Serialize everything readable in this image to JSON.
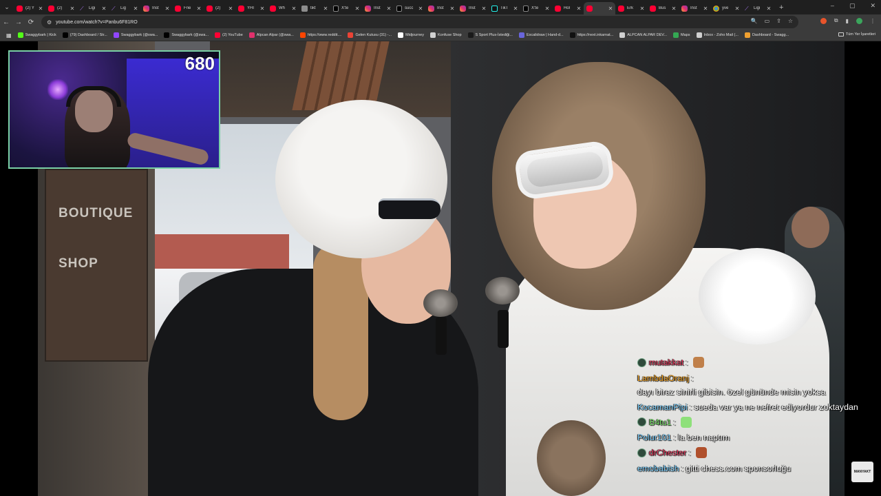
{
  "tabs": [
    {
      "title": "(2) Y",
      "fav": "yt"
    },
    {
      "title": "(2)",
      "fav": "yt"
    },
    {
      "title": "Ligi",
      "fav": "lig"
    },
    {
      "title": "Lig",
      "fav": "lig"
    },
    {
      "title": "Inst",
      "fav": "ig"
    },
    {
      "title": "Frie",
      "fav": "yt"
    },
    {
      "title": "(2)",
      "fav": "yt"
    },
    {
      "title": "YHI",
      "fav": "yt"
    },
    {
      "title": "Wh",
      "fav": "yt"
    },
    {
      "title": "tikt",
      "fav": "doc"
    },
    {
      "title": "X'te",
      "fav": "x"
    },
    {
      "title": "Inst",
      "fav": "ig"
    },
    {
      "title": "succ",
      "fav": "x"
    },
    {
      "title": "Inst",
      "fav": "ig"
    },
    {
      "title": "Inst",
      "fav": "ig"
    },
    {
      "title": "TikT",
      "fav": "tt"
    },
    {
      "title": "X'te",
      "fav": "x"
    },
    {
      "title": "Hol",
      "fav": "yt"
    },
    {
      "title": "",
      "fav": "yt",
      "active": true
    },
    {
      "title": "Erk",
      "fav": "yt"
    },
    {
      "title": "Bus",
      "fav": "yt"
    },
    {
      "title": "Inst",
      "fav": "ig"
    },
    {
      "title": "yve",
      "fav": "chrome"
    },
    {
      "title": "Ligi",
      "fav": "lig"
    }
  ],
  "toolbar": {
    "url": "youtube.com/watch?v=Panbu6F81RO"
  },
  "bookmarks": [
    {
      "label": "Swaggybark | Kick",
      "color": "#53fc18"
    },
    {
      "label": "(79) Dashboard / Str...",
      "color": "#000000"
    },
    {
      "label": "Swaggybark (@swa...",
      "color": "#9146ff"
    },
    {
      "label": "Swaggybark (@swa...",
      "color": "#000000"
    },
    {
      "label": "(2) YouTube",
      "color": "#ff0033"
    },
    {
      "label": "Alpcan Alpar (@swa...",
      "color": "#e1306c"
    },
    {
      "label": "https://www.reddit....",
      "color": "#ff4500"
    },
    {
      "label": "Gelen Kutusu (31) -...",
      "color": "#ea4335"
    },
    {
      "label": "Midjourney",
      "color": "#ffffff"
    },
    {
      "label": "Konfuse Shop",
      "color": "#d0d0d0"
    },
    {
      "label": "S Sport Plus-İstediği...",
      "color": "#1a1a1a"
    },
    {
      "label": "Excalidraw | Hand-d...",
      "color": "#6965db"
    },
    {
      "label": "https://next.inkarnat...",
      "color": "#111111"
    },
    {
      "label": "ALPCAN ALPAR DEV...",
      "color": "#d0d0d0"
    },
    {
      "label": "Maps",
      "color": "#34a853"
    },
    {
      "label": "Inbox - Zoho Mail (...",
      "color": "#d0d0d0"
    },
    {
      "label": "Dashboard - Swagg...",
      "color": "#f0a030"
    }
  ],
  "bookmarks_all": "Tüm Yer İşaretleri",
  "stream": {
    "viewer_count": "680",
    "signs": [
      "BOUTIQUE",
      "SHOP"
    ],
    "watermark": "MANYAKT"
  },
  "chat": [
    {
      "user": "mutakkat",
      "color": "#e0365a",
      "badge": true,
      "text": "",
      "emote": "#c0804a"
    },
    {
      "user": "LambdaOranj",
      "color": "#f0a020",
      "badge": false,
      "text": "dayı biraz sinirli gibisin. özel gününde misin yoksa"
    },
    {
      "user": "KocamanPipi",
      "color": "#7fd2ff",
      "badge": false,
      "text": "sueda var ya ne nefret ediyordur zoktaydan"
    },
    {
      "user": "B4tu1",
      "color": "#78e26a",
      "badge": true,
      "text": "",
      "emote": "#8ee07a"
    },
    {
      "user": "Polur101",
      "color": "#7fd2ff",
      "badge": false,
      "text": "la ben naptım"
    },
    {
      "user": "drChester",
      "color": "#e0365a",
      "badge": true,
      "text": "",
      "emote": "#b0502c"
    },
    {
      "user": "emobabish",
      "color": "#7fd2ff",
      "badge": false,
      "text": "gitti chess.com sponsorluğu"
    }
  ]
}
